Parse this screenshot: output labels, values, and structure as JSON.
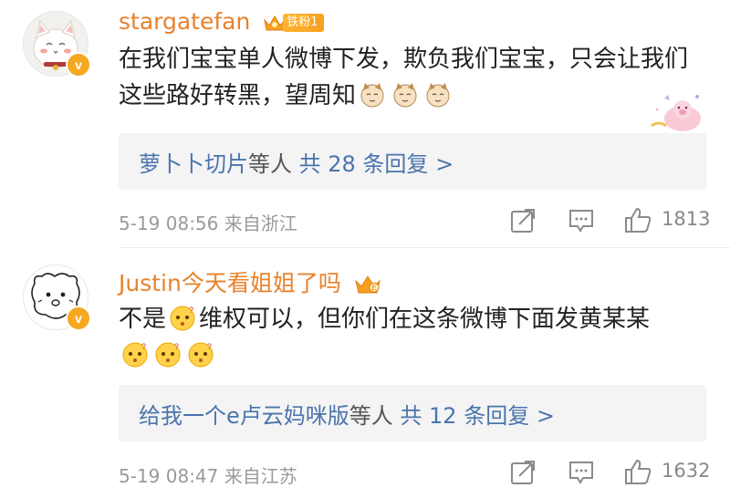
{
  "comments": [
    {
      "username": "stargatefan",
      "fan_badge": "铁粉1",
      "text": "在我们宝宝单人微博下发，欺负我们宝宝，只会让我们这些路好转黑，望周知",
      "emoji_trailing": [
        "cat-face-emoji",
        "cat-face-emoji",
        "cat-face-emoji"
      ],
      "reply_prefix": "萝卜卜切片",
      "reply_mid": "等人",
      "reply_count": "共 28 条回复 >",
      "meta": "5-19 08:56  来自浙江",
      "likes": "1813"
    },
    {
      "username": "Justin今天看姐姐了吗",
      "text_a": "不是",
      "text_b": "维权可以，但你们在这条微博下面发黄某某",
      "reply_prefix": "给我一个e卢云妈咪版",
      "reply_mid": "等人",
      "reply_count": "共 12 条回复 >",
      "meta": "5-19 08:47  来自江苏",
      "likes": "1632"
    }
  ],
  "colors": {
    "username": "#e8822b",
    "link": "#4a74ad",
    "meta": "#9a9a9a",
    "badge": "#f6a821"
  }
}
